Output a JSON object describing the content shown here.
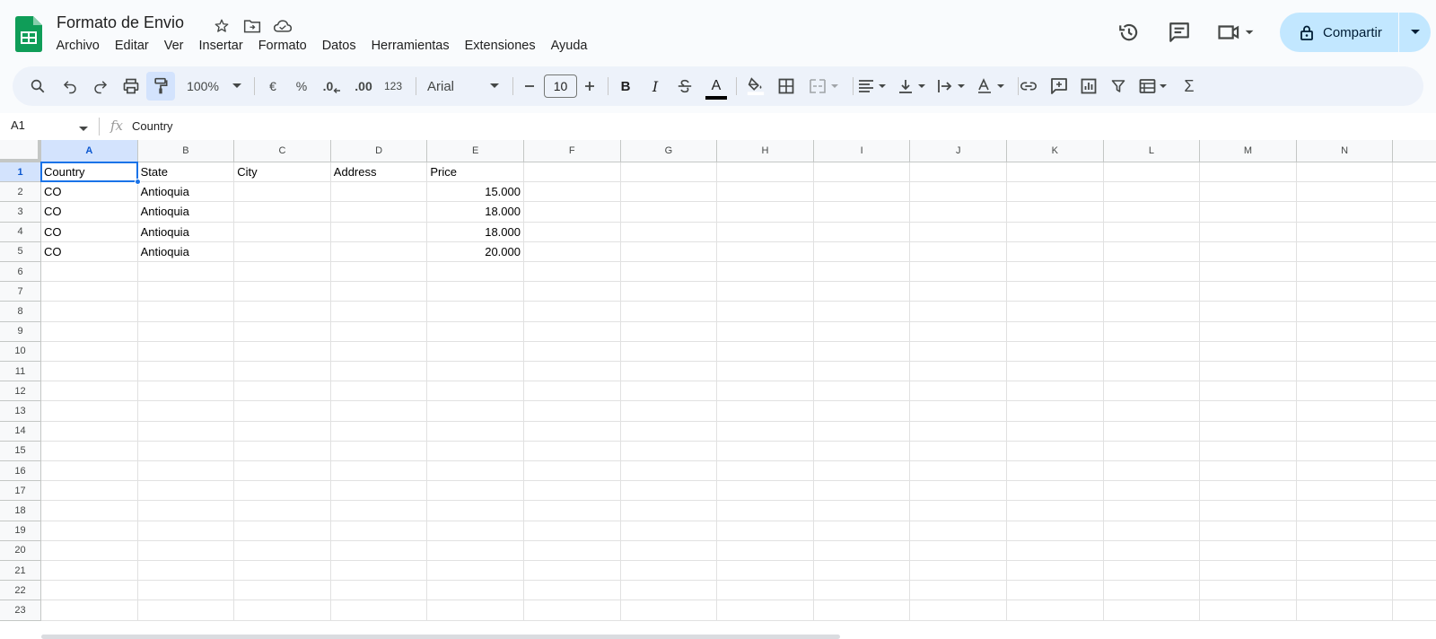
{
  "window": {
    "doc_title": "Formato de Envio",
    "menu": [
      "Archivo",
      "Editar",
      "Ver",
      "Insertar",
      "Formato",
      "Datos",
      "Herramientas",
      "Extensiones",
      "Ayuda"
    ],
    "share_label": "Compartir",
    "brand_color": "#0f9d58",
    "share_bg": "#c2e7ff"
  },
  "toolbar": {
    "zoom": "100%",
    "currency": "€",
    "percent": "%",
    "decimal_decrease": ".0",
    "decimal_increase": ".00",
    "number_format": "123",
    "font_family": "Arial",
    "font_size": "10",
    "bold": "B",
    "italic": "I",
    "text_color_letter": "A",
    "sum_symbol": "Σ"
  },
  "formula_bar": {
    "name_box": "A1",
    "fx_label": "fx",
    "content": "Country"
  },
  "sheet": {
    "columns": [
      "A",
      "B",
      "C",
      "D",
      "E",
      "F",
      "G",
      "H",
      "I",
      "J",
      "K",
      "L",
      "M",
      "N"
    ],
    "rows": [
      "1",
      "2",
      "3",
      "4",
      "5",
      "6",
      "7",
      "8",
      "9",
      "10",
      "11",
      "12",
      "13",
      "14",
      "15",
      "16",
      "17",
      "18",
      "19",
      "20",
      "21",
      "22",
      "23"
    ],
    "selected_column": "A",
    "selected_row": "1",
    "headers": [
      "Country",
      "State",
      "City",
      "Address",
      "Price"
    ],
    "data_rows": [
      [
        "CO",
        "Antioquia",
        "",
        "",
        "15.000"
      ],
      [
        "CO",
        "Antioquia",
        "",
        "",
        "18.000"
      ],
      [
        "CO",
        "Antioquia",
        "",
        "",
        "18.000"
      ],
      [
        "CO",
        "Antioquia",
        "",
        "",
        "20.000"
      ]
    ],
    "selection_color": "#1a73e8"
  }
}
